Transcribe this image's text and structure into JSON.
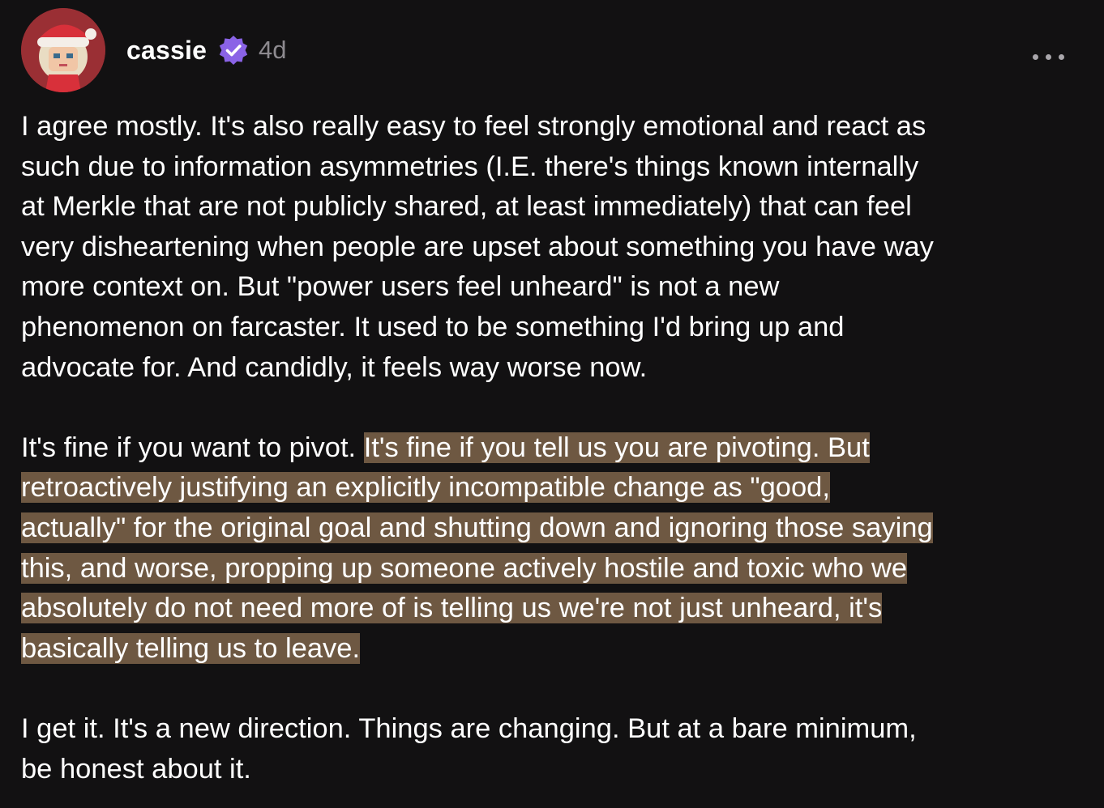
{
  "post": {
    "author": {
      "username": "cassie",
      "verified": true,
      "timestamp": "4d",
      "avatar_icon": "santa-hat-avatar-icon"
    },
    "more_options_icon": "ellipsis-icon",
    "highlight_color": "#6e5842",
    "paragraph1_lines": [
      "I agree mostly. It's also really easy to feel strongly emotional and react as",
      "such due to information asymmetries (I.E. there's things known internally",
      "at Merkle that are not publicly shared, at least immediately) that can feel",
      "very disheartening when people are upset about something you have way",
      "more context on. But \"power users feel unheard\" is not a new",
      "phenomenon on farcaster. It used to be something I'd bring up and",
      "advocate for. And candidly, it feels way worse now."
    ],
    "paragraph2_plain": "It's fine if you want to pivot. ",
    "paragraph2_highlight_lines": [
      "It's fine if you tell us you are pivoting. But",
      "retroactively justifying an explicitly incompatible change as \"good,",
      "actually\" for the original goal and shutting down and ignoring those saying",
      "this, and worse, propping up someone actively hostile and toxic who we",
      "absolutely do not need more of is telling us we're not just unheard, it's",
      "basically telling us to leave."
    ],
    "paragraph3_lines": [
      "I get it. It's a new direction. Things are changing. But at a bare minimum,",
      "be honest about it."
    ]
  }
}
